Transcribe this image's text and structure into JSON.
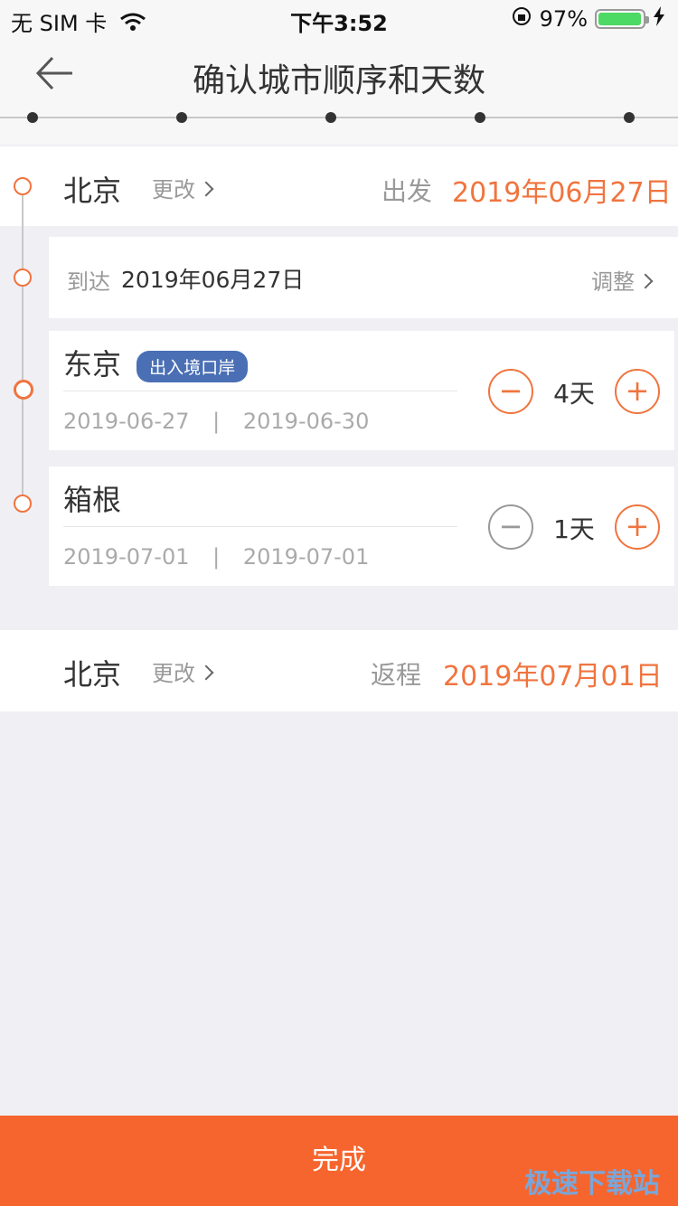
{
  "status_bar": {
    "carrier": "无 SIM 卡",
    "time": "下午3:52",
    "battery": "97%"
  },
  "header": {
    "title": "确认城市顺序和天数"
  },
  "departure": {
    "city": "北京",
    "change_label": "更改",
    "label": "出发",
    "date": "2019年06月27日"
  },
  "arrival": {
    "label": "到达",
    "date": "2019年06月27日",
    "adjust_label": "调整"
  },
  "stops": [
    {
      "city": "东京",
      "badge": "出入境口岸",
      "start": "2019-06-27",
      "end": "2019-06-30",
      "days": "4天",
      "separator": "|"
    },
    {
      "city": "箱根",
      "start": "2019-07-01",
      "end": "2019-07-01",
      "days": "1天",
      "separator": "|"
    }
  ],
  "return": {
    "city": "北京",
    "change_label": "更改",
    "label": "返程",
    "date": "2019年07月01日"
  },
  "footer": {
    "done_label": "完成"
  },
  "watermark": "极速下载站",
  "colors": {
    "accent": "#f0743e",
    "button": "#f6652d",
    "badge": "#4a6fb5"
  }
}
